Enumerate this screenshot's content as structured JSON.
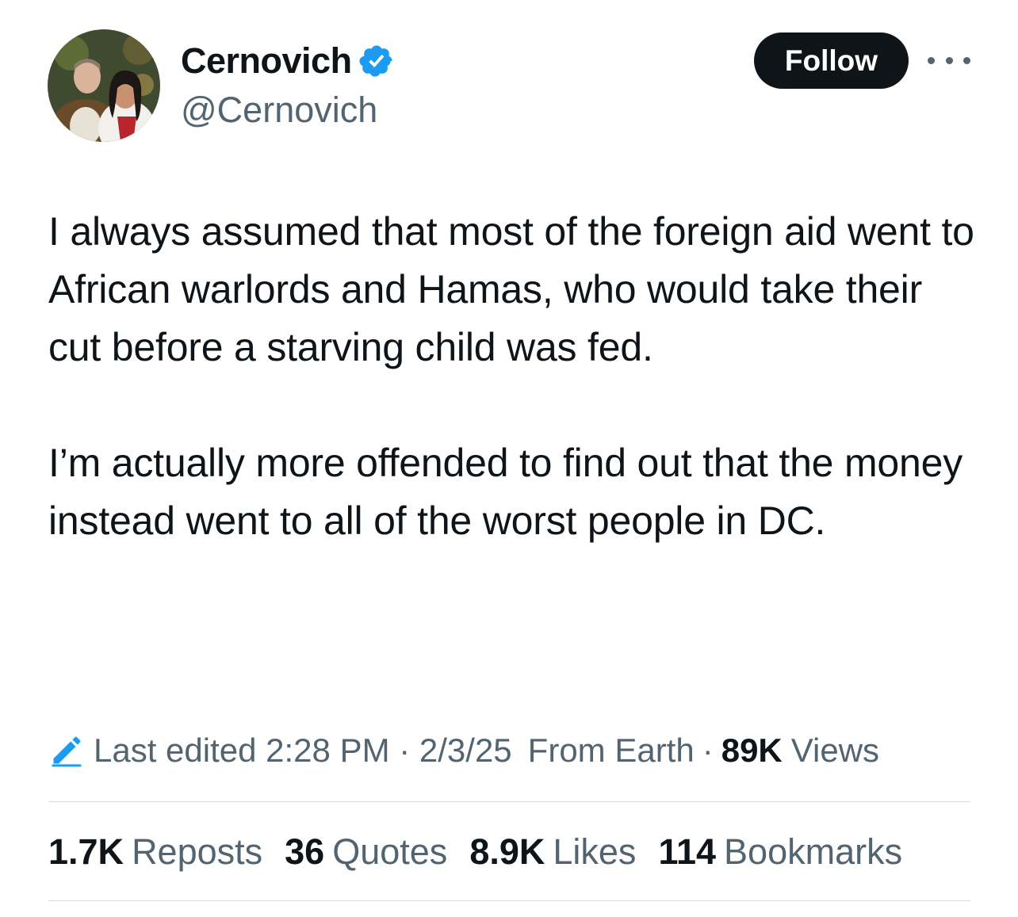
{
  "author": {
    "display_name": "Cernovich",
    "handle": "@Cernovich",
    "verified": true
  },
  "actions": {
    "follow_label": "Follow",
    "more_icon": "more-horizontal-icon"
  },
  "tweet": {
    "paragraphs": [
      "I always assumed that most of the foreign aid went to African warlords and Hamas, who would take their cut before a starving child was fed.",
      "I’m actually more offended to find out that the money instead went to all of the worst people in DC."
    ]
  },
  "meta": {
    "edit_icon": "pencil-icon",
    "last_edited": "Last edited 2:28 PM · 2/3/25",
    "location": "From Earth",
    "separator": "·",
    "views_count": "89K",
    "views_label": "Views"
  },
  "stats": [
    {
      "count": "1.7K",
      "label": "Reposts"
    },
    {
      "count": "36",
      "label": "Quotes"
    },
    {
      "count": "8.9K",
      "label": "Likes"
    },
    {
      "count": "114",
      "label": "Bookmarks"
    }
  ],
  "colors": {
    "text_primary": "#0f1419",
    "text_secondary": "#536471",
    "verified_blue": "#1d9bf0",
    "follow_bg": "#0f1419",
    "divider": "#d8dde2"
  }
}
